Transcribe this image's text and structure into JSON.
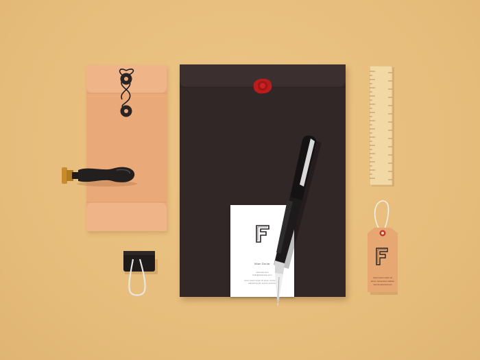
{
  "scene": {
    "colors": {
      "background": "#e8bf7f",
      "kraft_envelope": "#eaa979",
      "folder": "#322727",
      "wax_seal": "#b81c1c",
      "card": "#ffffff",
      "tag": "#e6a773",
      "ruler": "#f1d8a4"
    }
  },
  "business_card": {
    "logo_letter": "F",
    "name": "Mian Dorlar",
    "line_1": "www.site.com",
    "line_2": "hello@sitename.com",
    "line_3": "lorem ipsum dolor sit amet, consectetur",
    "line_4": "adipiscing elit, sed do eiusmod"
  },
  "hang_tag": {
    "logo_letter": "F",
    "line_1": "lorem ipsum dolor sit",
    "line_2": "amet, consectetur adipisc",
    "line_3": "sed do eiusmod tem"
  }
}
